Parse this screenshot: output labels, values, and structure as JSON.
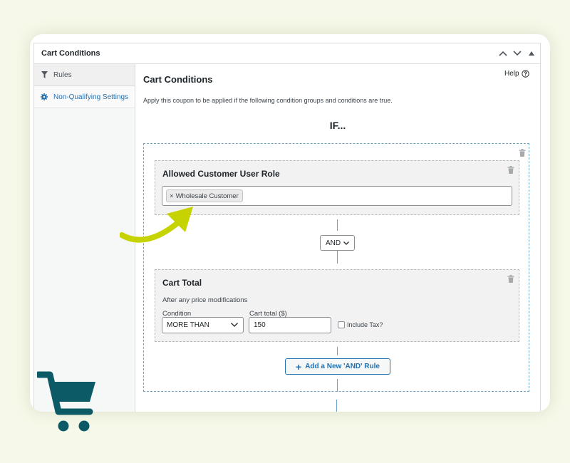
{
  "panel": {
    "title": "Cart Conditions"
  },
  "sidebar": {
    "items": [
      {
        "label": "Rules",
        "icon": "filter-icon",
        "active": true
      },
      {
        "label": "Non-Qualifying Settings",
        "icon": "gear-icon",
        "active": false
      }
    ]
  },
  "main": {
    "title": "Cart Conditions",
    "help_label": "Help",
    "description": "Apply this coupon to be applied if the following condition groups and conditions are true.",
    "if_label": "IF...",
    "role_condition": {
      "title": "Allowed Customer User Role",
      "tags": [
        "Wholesale Customer"
      ],
      "remove_glyph": "×"
    },
    "logic_operator": "AND",
    "cart_total_condition": {
      "title": "Cart Total",
      "subtitle": "After any price modifications",
      "condition_label": "Condition",
      "condition_value": "MORE THAN",
      "total_label": "Cart total ($)",
      "total_value": "150",
      "include_tax_label": "Include Tax?"
    },
    "add_rule_label": "Add a New 'AND' Rule"
  },
  "colors": {
    "background": "#f6f8e9",
    "link_blue": "#2271b1",
    "dashed_blue": "#6fa3c8",
    "arrow_green": "#c7d300",
    "cart_teal": "#0c5a66"
  }
}
